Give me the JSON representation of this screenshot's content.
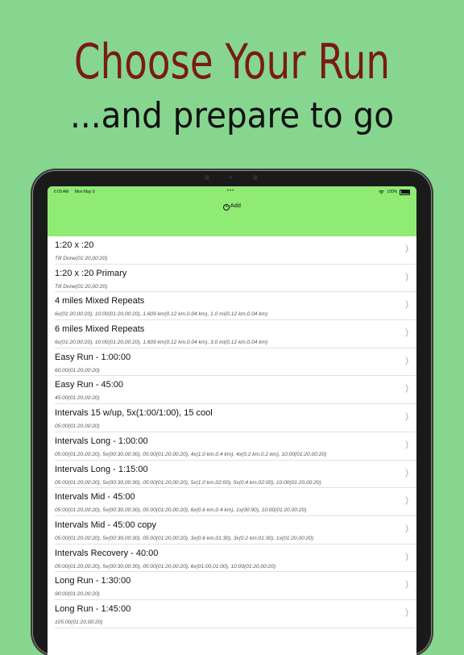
{
  "headline": "Choose Your Run",
  "subline": "...and prepare to go",
  "status_bar": {
    "time": "6:09 AM",
    "date": "Mon May 9",
    "dots": "•••",
    "battery": "100%"
  },
  "header": {
    "add_label": "Add",
    "add_icon": "plus-circle-icon",
    "color": "#90eb74"
  },
  "colors": {
    "background": "#86d68f",
    "headline": "#7a1a17"
  },
  "runs": [
    {
      "title": "1:20 x :20",
      "detail": "Till Done(01:20,00:20)"
    },
    {
      "title": "1:20 x :20 Primary",
      "detail": "Till Done(01:20,00:20)"
    },
    {
      "title": "4 miles Mixed Repeats",
      "detail": "6x(01:20,00:20), 10:00(01:20,00:20), 1.609 km(0.12 km,0.04 km), 1.0 mi(0.12 km,0.04 km)"
    },
    {
      "title": "6 miles Mixed Repeats",
      "detail": "6x(01:20,00:20), 10:00(01:20,00:20), 1.609 km(0.12 km,0.04 km), 3.0 mi(0.12 km,0.04 km)"
    },
    {
      "title": "Easy Run - 1:00:00",
      "detail": "60:00(01:20,00:20)"
    },
    {
      "title": "Easy Run - 45:00",
      "detail": "45:00(01:20,00:20)"
    },
    {
      "title": "Intervals 15 w/up, 5x(1:00/1:00), 15 cool",
      "detail": "05:00(01:20,00:20)"
    },
    {
      "title": "Intervals Long - 1:00:00",
      "detail": "05:00(01:20,00:20), 5x(00:30,00:30), 05:00(01:20,00:20), 4x(1.0 km,0.4 km), 4x(0.2 km,0.2 km), 10:00(01:20,00:20)"
    },
    {
      "title": "Intervals Long - 1:15:00",
      "detail": "05:00(01:20,00:20), 5x(00:30,00:30), 05:00(01:20,00:20), 5x(1.0 km,02:00), 5x(0.4 km,02:00), 10:00(01:20,00:20)"
    },
    {
      "title": "Intervals Mid - 45:00",
      "detail": "05:00(01:20,00:20), 5x(00:30,00:30), 05:00(01:20,00:20), 6x(0.6 km,0.4 km), 1x(00:90), 10:00(01:20,00:20)"
    },
    {
      "title": "Intervals Mid - 45:00 copy",
      "detail": "05:00(01:20,00:20), 5x(00:30,00:30), 05:00(01:20,00:20), 3x(0.6 km,01:30), 3x(0.2 km,01:30), 1x(01:20,00:20)"
    },
    {
      "title": "Intervals Recovery - 40:00",
      "detail": "05:00(01:20,00:20), 5x(00:30,00:30), 05:00(01:20,00:20), 6x(01:00,01:00), 10:00(01:20,00:20)"
    },
    {
      "title": "Long Run - 1:30:00",
      "detail": "90:00(01:20,00:20)"
    },
    {
      "title": "Long Run - 1:45:00",
      "detail": "105:00(01:20,00:20)"
    }
  ]
}
